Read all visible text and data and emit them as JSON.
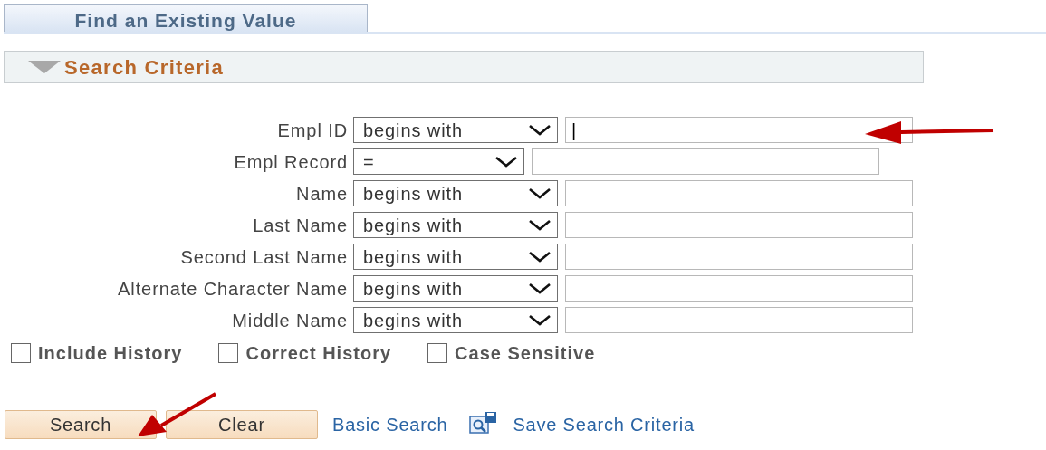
{
  "tabs": [
    {
      "label": "Find an Existing Value",
      "selected": true
    }
  ],
  "section": {
    "title": "Search Criteria",
    "expanded": true
  },
  "criteria": [
    {
      "label": "Empl ID",
      "operator": "begins with",
      "value": "|",
      "kind": "wide"
    },
    {
      "label": "Empl Record",
      "operator": "=",
      "kind": "narrow"
    },
    {
      "label": "Name",
      "operator": "begins with",
      "kind": "wide"
    },
    {
      "label": "Last Name",
      "operator": "begins with",
      "kind": "wide"
    },
    {
      "label": "Second Last Name",
      "operator": "begins with",
      "kind": "wide"
    },
    {
      "label": "Alternate Character Name",
      "operator": "begins with",
      "kind": "wide"
    },
    {
      "label": "Middle Name",
      "operator": "begins with",
      "kind": "wide"
    }
  ],
  "options": [
    {
      "label": "Include History",
      "checked": false
    },
    {
      "label": "Correct History",
      "checked": false
    },
    {
      "label": "Case Sensitive",
      "checked": false
    }
  ],
  "buttons": [
    "Search",
    "Clear"
  ],
  "links": [
    "Basic Search",
    "Save Search Criteria"
  ]
}
